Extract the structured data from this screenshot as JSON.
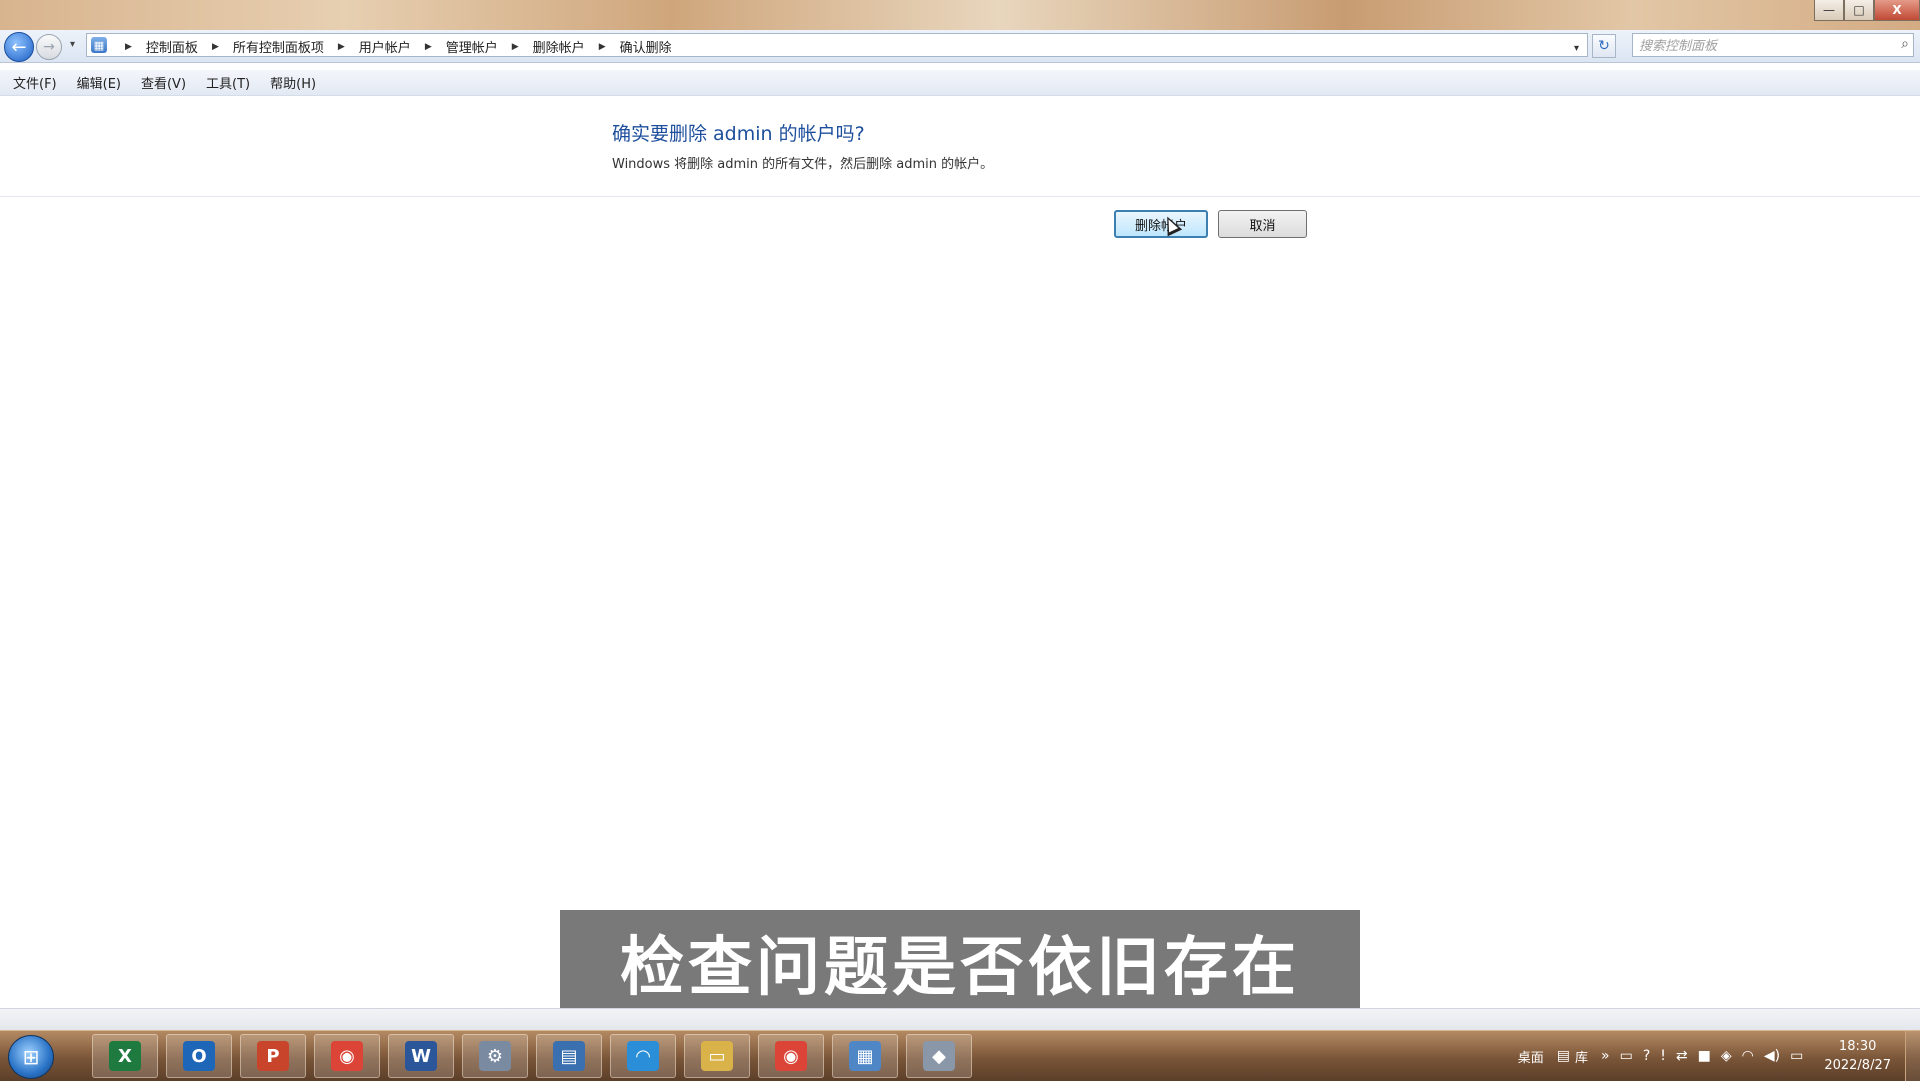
{
  "window": {
    "controls": {
      "minimize": "—",
      "maximize": "□",
      "close": "X"
    }
  },
  "address_bar": {
    "back_icon": "←",
    "forward_icon": "→",
    "dropdown_icon": "▾",
    "breadcrumbs": [
      "控制面板",
      "所有控制面板项",
      "用户帐户",
      "管理帐户",
      "删除帐户",
      "确认删除"
    ],
    "separator": "▶",
    "refresh_icon": "↻",
    "search_placeholder": "搜索控制面板",
    "search_icon": "⌕"
  },
  "menu": {
    "items": [
      "文件(F)",
      "编辑(E)",
      "查看(V)",
      "工具(T)",
      "帮助(H)"
    ]
  },
  "dialog": {
    "title": "确实要删除 admin 的帐户吗?",
    "description": "Windows 将删除 admin 的所有文件，然后删除 admin 的帐户。",
    "delete_button": "删除帐户",
    "cancel_button": "取消"
  },
  "subtitle": "检查问题是否依旧存在",
  "taskbar": {
    "start_icon": "windows-start-orb",
    "apps": [
      {
        "name": "excel",
        "glyph": "X",
        "color": "#1f7a3f"
      },
      {
        "name": "outlook",
        "glyph": "O",
        "color": "#1e66b8"
      },
      {
        "name": "powerpoint",
        "glyph": "P",
        "color": "#c8452c"
      },
      {
        "name": "chrome",
        "glyph": "◉",
        "color": "#db4437"
      },
      {
        "name": "word",
        "glyph": "W",
        "color": "#2b579a"
      },
      {
        "name": "app-6",
        "glyph": "⚙",
        "color": "#7a8aa0"
      },
      {
        "name": "app-7",
        "glyph": "▤",
        "color": "#3a6fb0"
      },
      {
        "name": "wifi-app",
        "glyph": "◠",
        "color": "#2a8fd8"
      },
      {
        "name": "explorer",
        "glyph": "▭",
        "color": "#d9b24a"
      },
      {
        "name": "chrome-2",
        "glyph": "◉",
        "color": "#db4437"
      },
      {
        "name": "control-panel",
        "glyph": "▦",
        "color": "#4f86c6"
      },
      {
        "name": "app-12",
        "glyph": "◆",
        "color": "#8a97a8"
      }
    ],
    "tray": {
      "desktop_label": "桌面",
      "library_label": "库",
      "expand": "»",
      "icons": [
        "▭",
        "?",
        "!",
        "⇄",
        "■",
        "◈",
        "◠",
        "◀)",
        "▭"
      ],
      "time": "18:30",
      "date": "2022/8/27"
    }
  }
}
